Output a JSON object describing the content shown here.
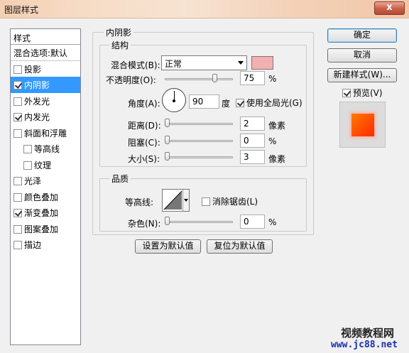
{
  "window": {
    "title": "图层样式",
    "close_label": "x"
  },
  "sidebar": {
    "header": "样式",
    "blend_options": "混合选项:默认",
    "items": [
      {
        "label": "投影",
        "checked": false,
        "selected": false,
        "indent": false
      },
      {
        "label": "内阴影",
        "checked": true,
        "selected": true,
        "indent": false
      },
      {
        "label": "外发光",
        "checked": false,
        "selected": false,
        "indent": false
      },
      {
        "label": "内发光",
        "checked": true,
        "selected": false,
        "indent": false
      },
      {
        "label": "斜面和浮雕",
        "checked": false,
        "selected": false,
        "indent": false
      },
      {
        "label": "等高线",
        "checked": false,
        "selected": false,
        "indent": true
      },
      {
        "label": "纹理",
        "checked": false,
        "selected": false,
        "indent": true
      },
      {
        "label": "光泽",
        "checked": false,
        "selected": false,
        "indent": false
      },
      {
        "label": "颜色叠加",
        "checked": false,
        "selected": false,
        "indent": false
      },
      {
        "label": "渐变叠加",
        "checked": true,
        "selected": false,
        "indent": false
      },
      {
        "label": "图案叠加",
        "checked": false,
        "selected": false,
        "indent": false
      },
      {
        "label": "描边",
        "checked": false,
        "selected": false,
        "indent": false
      }
    ]
  },
  "panel": {
    "title": "内阴影",
    "structure": {
      "title": "结构",
      "blend_mode_label": "混合模式(B):",
      "blend_mode_value": "正常",
      "blend_color": "#f4b0b0",
      "opacity_label": "不透明度(O):",
      "opacity_value": "75",
      "opacity_fraction": 0.75,
      "opacity_unit": "%",
      "angle_label": "角度(A):",
      "angle_value": "90",
      "angle_unit": "度",
      "global_light_label": "使用全局光(G)",
      "global_light_checked": true,
      "distance_label": "距离(D):",
      "distance_value": "2",
      "distance_unit": "像素",
      "distance_fraction": 0.0,
      "choke_label": "阻塞(C):",
      "choke_value": "0",
      "choke_unit": "%",
      "choke_fraction": 0.0,
      "size_label": "大小(S):",
      "size_value": "3",
      "size_unit": "像素",
      "size_fraction": 0.0
    },
    "quality": {
      "title": "品质",
      "contour_label": "等高线:",
      "antialias_label": "消除锯齿(L)",
      "antialias_checked": false,
      "noise_label": "杂色(N):",
      "noise_value": "0",
      "noise_unit": "%",
      "noise_fraction": 0.0
    },
    "set_default_label": "设置为默认值",
    "reset_default_label": "复位为默认值"
  },
  "actions": {
    "ok_label": "确定",
    "cancel_label": "取消",
    "new_style_label": "新建样式(W)...",
    "preview_label": "预览(V)",
    "preview_checked": true
  },
  "watermark": {
    "line1": "视频教程网",
    "line2": "www.jc88.net"
  }
}
